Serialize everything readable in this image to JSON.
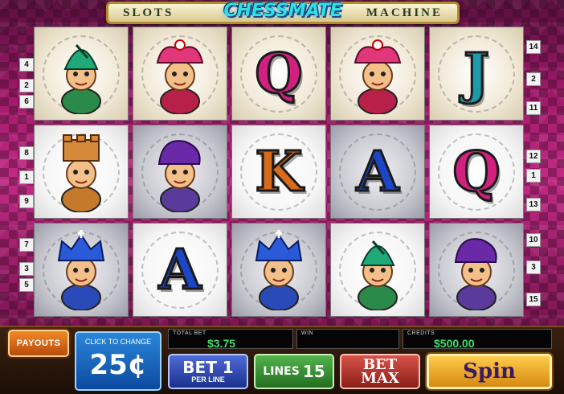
{
  "title": {
    "left": "SLOTS",
    "logo": "CHESSMATE",
    "right": "MACHINE"
  },
  "paylines_left": [
    "4",
    "2",
    "6",
    "8",
    "1",
    "9",
    "7",
    "3",
    "5"
  ],
  "paylines_right": [
    "14",
    "2",
    "11",
    "12",
    "1",
    "13",
    "10",
    "3",
    "15"
  ],
  "reels": [
    [
      "bishop-character",
      "queen-character",
      "q-symbol",
      "queen-character",
      "j-symbol"
    ],
    [
      "rook-character",
      "pawn-character",
      "k-symbol",
      "a-symbol",
      "q-symbol"
    ],
    [
      "king-character",
      "a-symbol",
      "king-character",
      "bishop-character",
      "pawn-character"
    ]
  ],
  "letters": {
    "q": "Q",
    "j": "J",
    "k": "K",
    "a": "A"
  },
  "letter_colors": {
    "q": "#d1207e",
    "j": "#1f9aa8",
    "k": "#d86a1c",
    "a": "#1c46c6"
  },
  "controls": {
    "payouts_label": "PAYOUTS",
    "change_hint": "CLICK TO CHANGE",
    "coin_value": "25¢",
    "total_bet_label": "TOTAL BET",
    "total_bet_value": "$3.75",
    "win_label": "WIN",
    "win_value": "",
    "credits_label": "CREDITS",
    "credits_value": "$500.00",
    "bet_label": "BET 1",
    "bet_sub": "PER LINE",
    "lines_label": "LINES",
    "lines_value": "15",
    "betmax_line1": "BET",
    "betmax_line2": "MAX",
    "spin_label": "Spin"
  }
}
